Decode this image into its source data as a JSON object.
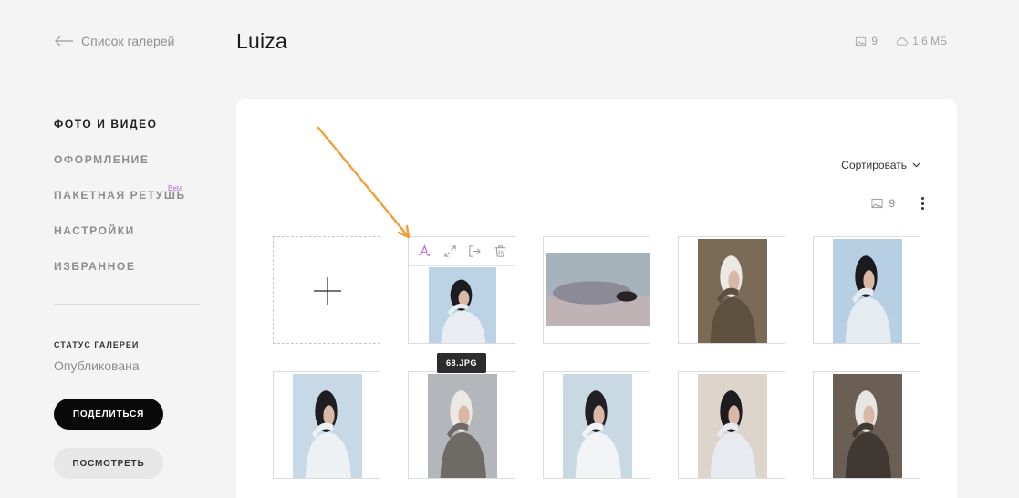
{
  "header": {
    "back_label": "Список галерей",
    "title": "Luiza",
    "photo_count": "9",
    "storage": "1.6 МБ"
  },
  "sidebar": {
    "items": [
      {
        "label": "ФОТО И ВИДЕО",
        "active": true
      },
      {
        "label": "ОФОРМЛЕНИЕ",
        "active": false
      },
      {
        "label": "ПАКЕТНАЯ РЕТУШЬ",
        "active": false,
        "badge": "Beta"
      },
      {
        "label": "НАСТРОЙКИ",
        "active": false
      },
      {
        "label": "ИЗБРАННОЕ",
        "active": false
      }
    ],
    "status_label": "СТАТУС ГАЛЕРЕИ",
    "status_value": "Опубликована",
    "share_label": "ПОДЕЛИТЬСЯ",
    "view_label": "ПОСМОТРЕТЬ"
  },
  "gallery": {
    "sort_label": "Сортировать",
    "count": "9",
    "hover_filename": "68.JPG",
    "toolbar_icons": [
      "retouch-icon",
      "expand-icon",
      "move-icon",
      "trash-icon"
    ],
    "photos": [
      {
        "name": "photo-1",
        "orientation": "portrait",
        "palette": [
          "#bcd3e6",
          "#1c1c22",
          "#e9edf2"
        ]
      },
      {
        "name": "photo-2",
        "orientation": "landscape",
        "palette": [
          "#a7b3bb",
          "#f0f1f3",
          "#8c8a94"
        ]
      },
      {
        "name": "photo-3",
        "orientation": "portrait",
        "palette": [
          "#7a6b57",
          "#ece8e4",
          "#5d503f"
        ]
      },
      {
        "name": "photo-4",
        "orientation": "portrait",
        "palette": [
          "#b6cfe2",
          "#1a1a1f",
          "#e6ebf0"
        ]
      },
      {
        "name": "photo-5",
        "orientation": "portrait",
        "palette": [
          "#c7d8e6",
          "#1d1d22",
          "#eef1f4"
        ]
      },
      {
        "name": "photo-6",
        "orientation": "portrait",
        "palette": [
          "#b3b7bb",
          "#ebe8e6",
          "#6e6a66"
        ]
      },
      {
        "name": "photo-7",
        "orientation": "portrait",
        "palette": [
          "#c9d9e4",
          "#1f1f24",
          "#f2f3f5"
        ]
      },
      {
        "name": "photo-8",
        "orientation": "portrait",
        "palette": [
          "#ddd5cc",
          "#1c1c21",
          "#e7ebf0"
        ]
      },
      {
        "name": "photo-9",
        "orientation": "portrait",
        "palette": [
          "#6a5e55",
          "#e8e6e3",
          "#3f3833"
        ]
      }
    ]
  },
  "colors": {
    "accent_purple": "#b169d6",
    "annotation_arrow": "#f0a037",
    "share_button_bg": "#0a0a0a"
  }
}
